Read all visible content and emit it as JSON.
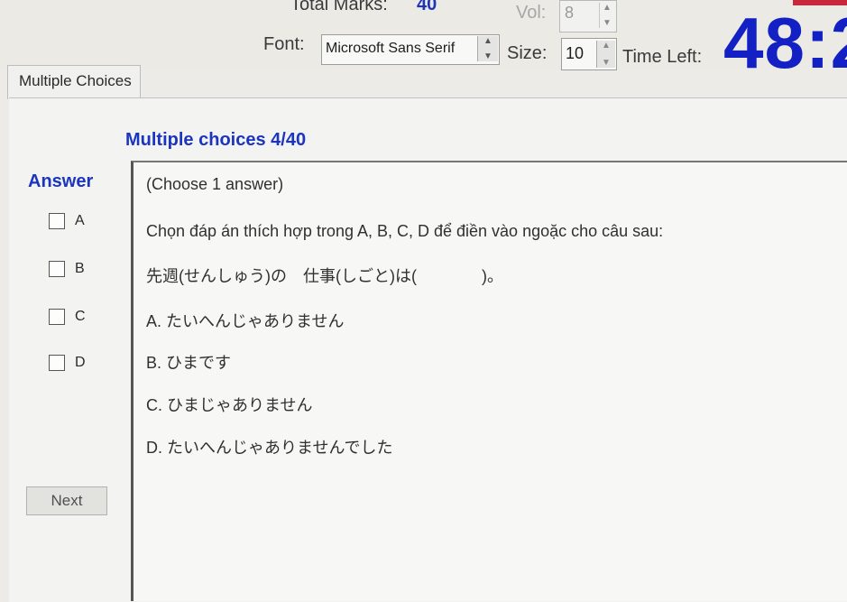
{
  "header": {
    "total_marks_label": "Total Marks:",
    "total_marks_value": "40",
    "vol_label": "Vol:",
    "vol_value": "8",
    "font_label": "Font:",
    "font_value": "Microsoft Sans Serif",
    "size_label": "Size:",
    "size_value": "10",
    "time_left_label": "Time Left:",
    "time_left_value": "48:2"
  },
  "tabs": [
    {
      "label": "Multiple Choices"
    }
  ],
  "question": {
    "heading": "Multiple choices 4/40",
    "instruction": "(Choose 1 answer)",
    "prompt": "Chọn đáp án thích hợp trong A, B, C, D để điền vào ngoặc cho câu sau:",
    "sentence": "先週(せんしゅう)の　仕事(しごと)は(　　　　)。",
    "choices": [
      "A. たいへんじゃありません",
      "B. ひまです",
      "C. ひまじゃありません",
      "D. たいへんじゃありませんでした"
    ]
  },
  "answer_panel": {
    "label": "Answer",
    "options": [
      "A",
      "B",
      "C",
      "D"
    ],
    "next_label": "Next"
  },
  "colors": {
    "accent_blue": "#1b35bf",
    "timer_blue": "#1320c4"
  }
}
